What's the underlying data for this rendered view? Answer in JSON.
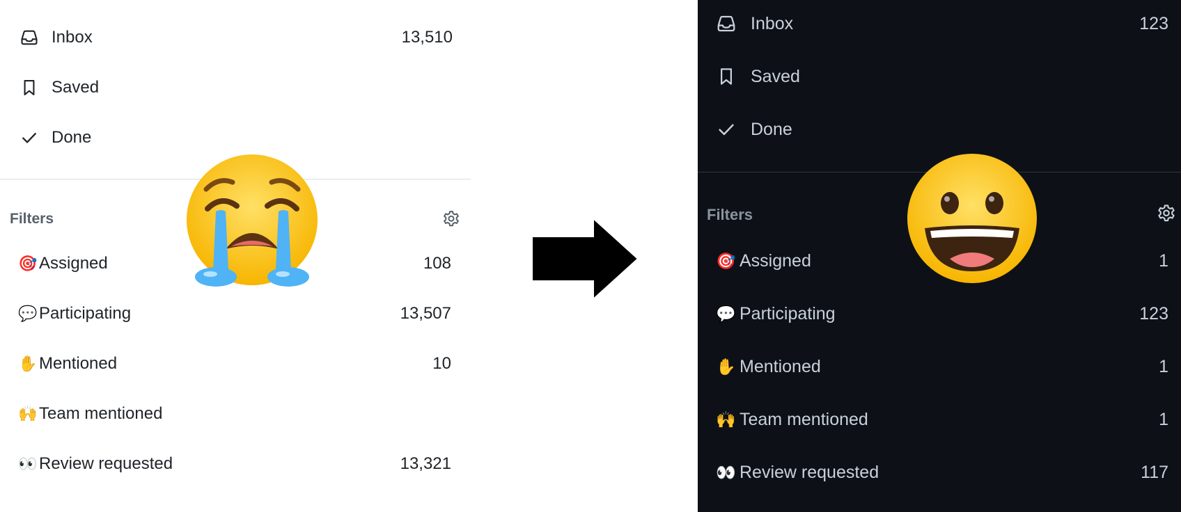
{
  "before": {
    "theme": "light",
    "nav": [
      {
        "label": "Inbox",
        "count": "13,510",
        "icon": "inbox-icon"
      },
      {
        "label": "Saved",
        "count": "",
        "icon": "bookmark-icon"
      },
      {
        "label": "Done",
        "count": "",
        "icon": "check-icon"
      }
    ],
    "filters_title": "Filters",
    "filters": [
      {
        "emoji": "🎯",
        "label": "Assigned",
        "count": "108"
      },
      {
        "emoji": "💬",
        "label": "Participating",
        "count": "13,507"
      },
      {
        "emoji": "✋",
        "label": "Mentioned",
        "count": "10"
      },
      {
        "emoji": "🙌",
        "label": "Team mentioned",
        "count": ""
      },
      {
        "emoji": "👀",
        "label": "Review requested",
        "count": "13,321"
      }
    ],
    "reaction": "crying-face-emoji"
  },
  "after": {
    "theme": "dark",
    "nav": [
      {
        "label": "Inbox",
        "count": "123",
        "icon": "inbox-icon"
      },
      {
        "label": "Saved",
        "count": "",
        "icon": "bookmark-icon"
      },
      {
        "label": "Done",
        "count": "",
        "icon": "check-icon"
      }
    ],
    "filters_title": "Filters",
    "filters": [
      {
        "emoji": "🎯",
        "label": "Assigned",
        "count": "1"
      },
      {
        "emoji": "💬",
        "label": "Participating",
        "count": "123"
      },
      {
        "emoji": "✋",
        "label": "Mentioned",
        "count": "1"
      },
      {
        "emoji": "🙌",
        "label": "Team mentioned",
        "count": "1"
      },
      {
        "emoji": "👀",
        "label": "Review requested",
        "count": "117"
      }
    ],
    "reaction": "grinning-face-emoji"
  },
  "transition": "right-arrow-icon",
  "colors": {
    "light_bg": "#ffffff",
    "dark_bg": "#0d1117",
    "light_text": "#1f2328",
    "dark_text": "#c9d1d9",
    "muted_light": "#57606a",
    "muted_dark": "#8b949e"
  }
}
